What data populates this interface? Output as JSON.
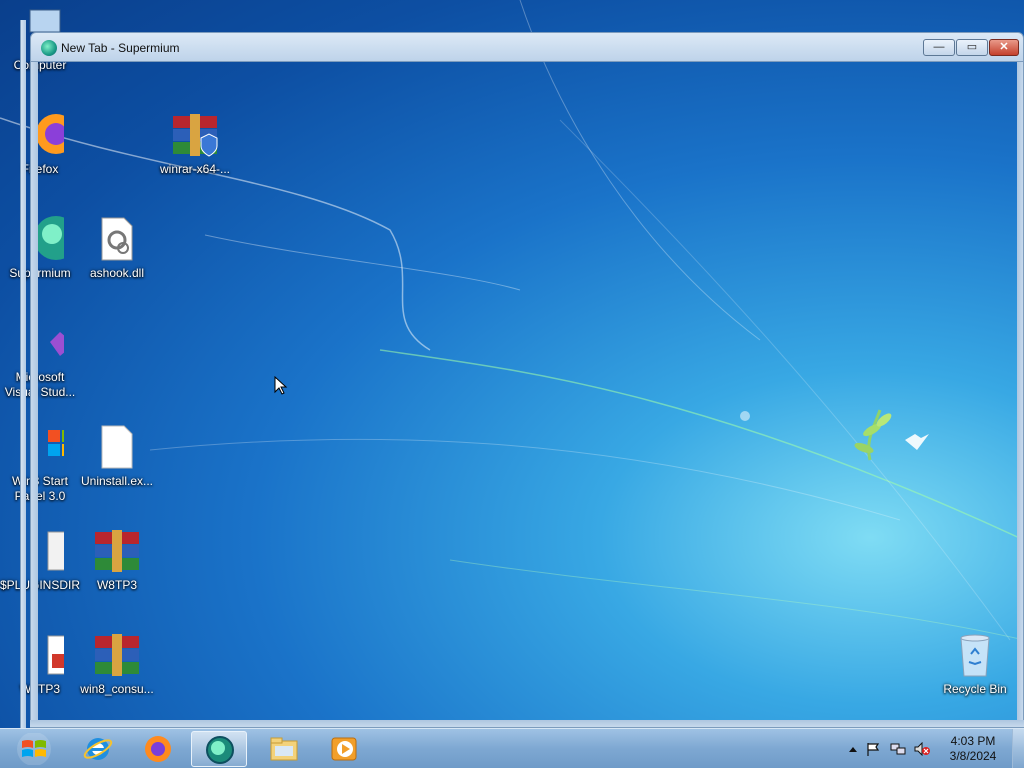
{
  "window": {
    "title": "New Tab - Supermium",
    "buttons": {
      "minimize": "—",
      "maximize": "▭",
      "close": "✕"
    }
  },
  "desktop_icons": [
    {
      "label": "Computer",
      "icon": "computer-icon"
    },
    {
      "label": "Firefox",
      "icon": "firefox-icon"
    },
    {
      "label": "Supermium",
      "icon": "supermium-icon"
    },
    {
      "label": "Microsoft Visual Stud...",
      "icon": "visual-studio-icon"
    },
    {
      "label": "Win8 Start Panel 3.0",
      "icon": "windows-flag-icon"
    },
    {
      "label": "$PLUGINSDIR",
      "icon": "folder-icon"
    },
    {
      "label": "W8TP3",
      "icon": "pdf-file-icon"
    },
    {
      "label": "winrar-x64-...",
      "icon": "winrar-installer-icon"
    },
    {
      "label": "ashook.dll",
      "icon": "dll-file-icon"
    },
    {
      "label": "Uninstall.ex...",
      "icon": "blank-file-icon"
    },
    {
      "label": "W8TP3",
      "icon": "winrar-archive-icon"
    },
    {
      "label": "win8_consu...",
      "icon": "winrar-archive-icon"
    },
    {
      "label": "Recycle Bin",
      "icon": "recycle-bin-icon"
    }
  ],
  "taskbar": {
    "items": [
      {
        "name": "start-button",
        "icon": "windows-logo-icon"
      },
      {
        "name": "internet-explorer",
        "icon": "internet-explorer-icon"
      },
      {
        "name": "firefox",
        "icon": "firefox-icon"
      },
      {
        "name": "supermium",
        "icon": "supermium-icon",
        "active": true
      },
      {
        "name": "file-explorer",
        "icon": "folder-icon"
      },
      {
        "name": "media-player",
        "icon": "media-player-icon"
      }
    ],
    "tray": {
      "icons": [
        "show-hidden-icons-arrow",
        "action-center-flag-icon",
        "network-icon",
        "volume-muted-icon"
      ],
      "time": "4:03 PM",
      "date": "3/8/2024"
    }
  },
  "colors": {
    "taskbar": "#7ea8d2",
    "wallpaper_dark": "#0d4fa3",
    "wallpaper_light": "#7fdcf4",
    "close_button": "#c4402c"
  }
}
